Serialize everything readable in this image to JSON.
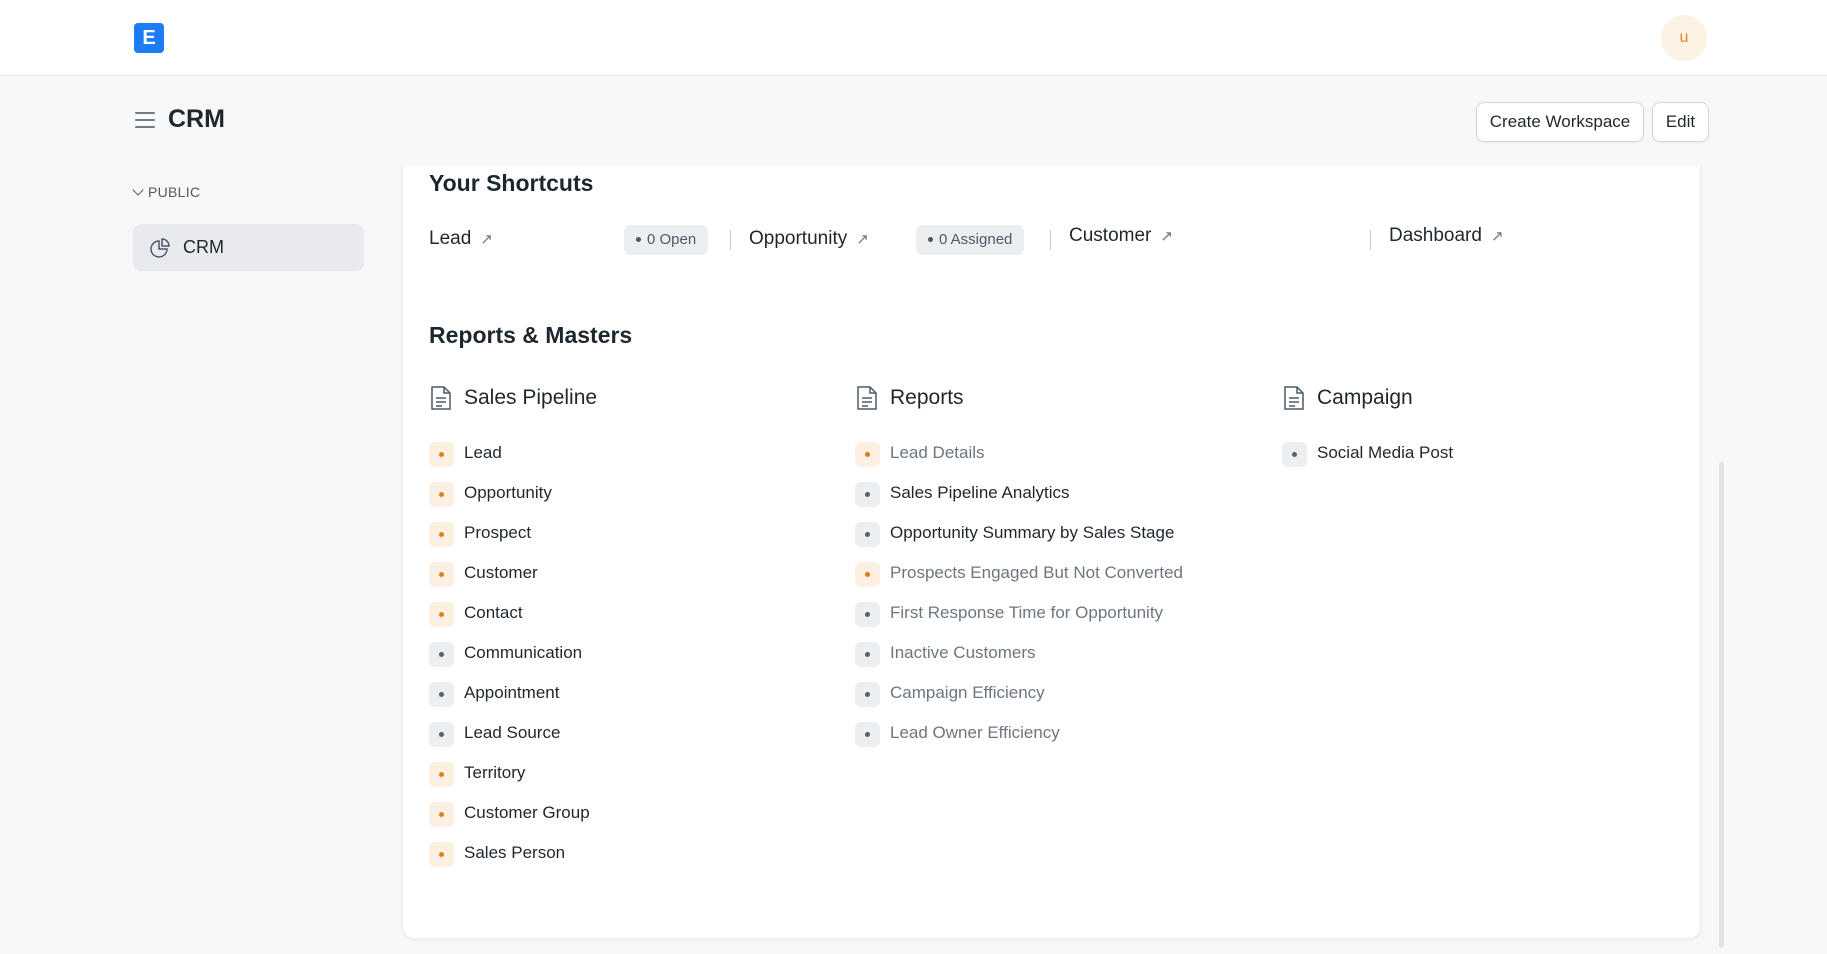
{
  "navbar": {
    "logo_text": "E",
    "avatar_initial": "u"
  },
  "page": {
    "title": "CRM"
  },
  "actions": {
    "create_workspace": "Create Workspace",
    "edit": "Edit"
  },
  "sidebar": {
    "section": "PUBLIC",
    "items": [
      {
        "label": "CRM",
        "icon": "pie-chart-icon"
      }
    ]
  },
  "shortcuts": {
    "title": "Your Shortcuts",
    "items": [
      {
        "label": "Lead",
        "count": "0 Open"
      },
      {
        "label": "Opportunity",
        "count": "0 Assigned"
      },
      {
        "label": "Customer",
        "count": ""
      },
      {
        "label": "Dashboard",
        "count": ""
      }
    ],
    "arrow": "↗"
  },
  "reports": {
    "title": "Reports & Masters",
    "columns": [
      {
        "title": "Sales Pipeline",
        "links": [
          {
            "label": "Lead",
            "tone": "orange"
          },
          {
            "label": "Opportunity",
            "tone": "orange"
          },
          {
            "label": "Prospect",
            "tone": "orange"
          },
          {
            "label": "Customer",
            "tone": "orange"
          },
          {
            "label": "Contact",
            "tone": "orange"
          },
          {
            "label": "Communication",
            "tone": "gray"
          },
          {
            "label": "Appointment",
            "tone": "gray"
          },
          {
            "label": "Lead Source",
            "tone": "gray"
          },
          {
            "label": "Territory",
            "tone": "orange"
          },
          {
            "label": "Customer Group",
            "tone": "orange"
          },
          {
            "label": "Sales Person",
            "tone": "orange"
          }
        ]
      },
      {
        "title": "Reports",
        "links": [
          {
            "label": "Lead Details",
            "tone": "orange",
            "muted": true
          },
          {
            "label": "Sales Pipeline Analytics",
            "tone": "gray",
            "muted": false
          },
          {
            "label": "Opportunity Summary by Sales Stage",
            "tone": "gray",
            "muted": false
          },
          {
            "label": "Prospects Engaged But Not Converted",
            "tone": "orange",
            "muted": true
          },
          {
            "label": "First Response Time for Opportunity",
            "tone": "gray",
            "muted": true
          },
          {
            "label": "Inactive Customers",
            "tone": "gray",
            "muted": true
          },
          {
            "label": "Campaign Efficiency",
            "tone": "gray",
            "muted": true
          },
          {
            "label": "Lead Owner Efficiency",
            "tone": "gray",
            "muted": true
          }
        ]
      },
      {
        "title": "Campaign",
        "links": [
          {
            "label": "Social Media Post",
            "tone": "gray",
            "muted": false
          }
        ]
      }
    ]
  },
  "colors": {
    "brand": "#1b7cf3",
    "accent_orange": "#e07b1a",
    "text": "#1f272e",
    "muted": "#6c7680"
  }
}
